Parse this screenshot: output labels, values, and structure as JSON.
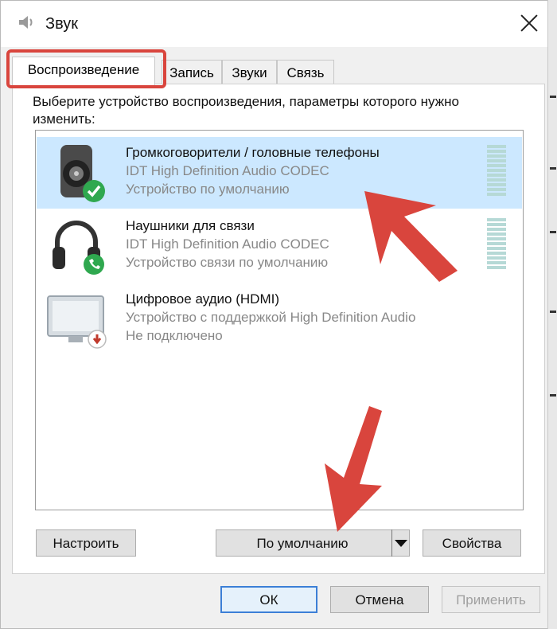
{
  "window": {
    "title": "Звук"
  },
  "tabs": [
    {
      "label": "Воспроизведение",
      "active": true
    },
    {
      "label": "Запись",
      "active": false
    },
    {
      "label": "Звуки",
      "active": false
    },
    {
      "label": "Связь",
      "active": false
    }
  ],
  "prompt": "Выберите устройство воспроизведения, параметры которого нужно изменить:",
  "devices": [
    {
      "name": "Громкоговорители / головные телефоны",
      "driver": "IDT High Definition Audio CODEC",
      "status": "Устройство по умолчанию",
      "icon": "speaker-icon",
      "badge": "check-badge-icon",
      "selected": true
    },
    {
      "name": "Наушники для связи",
      "driver": "IDT High Definition Audio CODEC",
      "status": "Устройство связи по умолчанию",
      "icon": "headphones-icon",
      "badge": "phone-badge-icon",
      "selected": false
    },
    {
      "name": "Цифровое аудио (HDMI)",
      "driver": "Устройство с поддержкой High Definition Audio",
      "status": "Не подключено",
      "icon": "monitor-icon",
      "badge": "disconnected-badge-icon",
      "selected": false
    }
  ],
  "buttons": {
    "configure": "Настроить",
    "set_default": "По умолчанию",
    "properties": "Свойства",
    "ok": "ОК",
    "cancel": "Отмена",
    "apply": "Применить"
  },
  "colors": {
    "annotation_red": "#d9453d",
    "selection": "#cce8ff",
    "default_badge_green": "#2fa84f"
  }
}
